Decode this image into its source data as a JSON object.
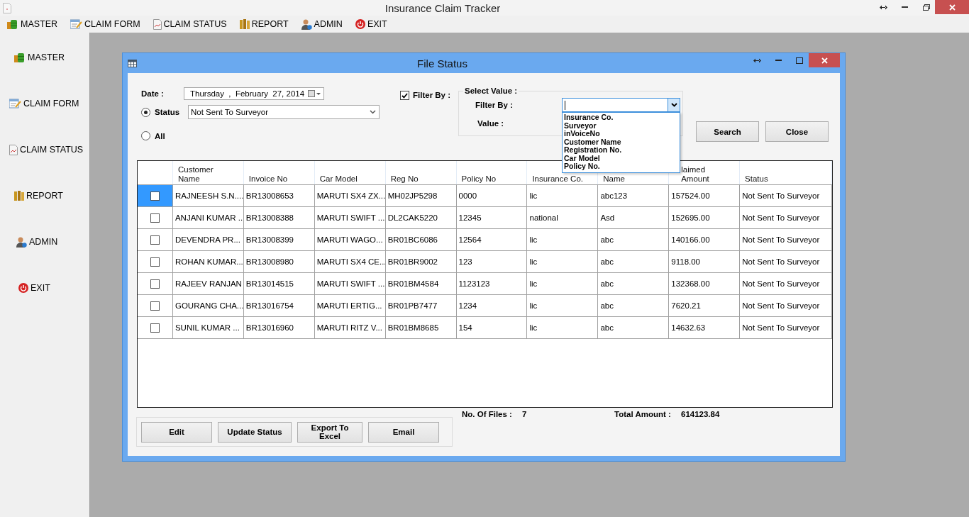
{
  "window": {
    "title": "Insurance Claim Tracker"
  },
  "menu": [
    {
      "label": "MASTER",
      "kind": "master"
    },
    {
      "label": "CLAIM FORM",
      "kind": "form"
    },
    {
      "label": "CLAIM STATUS",
      "kind": "status"
    },
    {
      "label": "REPORT",
      "kind": "report"
    },
    {
      "label": "ADMIN",
      "kind": "admin"
    },
    {
      "label": "EXIT",
      "kind": "exit"
    }
  ],
  "sidebar": {
    "items": [
      {
        "label": "MASTER",
        "kind": "master"
      },
      {
        "label": "CLAIM FORM",
        "kind": "form"
      },
      {
        "label": "CLAIM STATUS",
        "kind": "status"
      },
      {
        "label": "REPORT",
        "kind": "report"
      },
      {
        "label": "ADMIN",
        "kind": "admin"
      },
      {
        "label": "EXIT",
        "kind": "exit"
      }
    ]
  },
  "dialog": {
    "title": "File Status",
    "date": {
      "label": "Date :",
      "value": "Thursday  ,  February  27, 2014"
    },
    "status_radio": {
      "label": "Status",
      "selected": true,
      "value": "Not Sent To Surveyor"
    },
    "all_radio": {
      "label": "All",
      "selected": false
    },
    "filter_check": {
      "label": "Filter By :",
      "checked": true
    },
    "select_group": {
      "title": "Select Value :",
      "filter_label": "Filter By :",
      "value_label": "Value :",
      "expanded": true,
      "options": [
        "Insurance Co.",
        "Surveyor",
        "inVoiceNo",
        "Customer Name",
        "Registration No.",
        "Car Model",
        "Policy No."
      ]
    },
    "buttons": [
      "Search",
      "Close"
    ],
    "table": {
      "columns": [
        "Customer Name",
        "Invoice No",
        "Car Model",
        "Reg No",
        "Policy No",
        "Insurance Co.",
        "Name",
        "laimed Amount",
        "Status"
      ],
      "rows": [
        {
          "selected": true,
          "checked": false,
          "cells": [
            "RAJNEESH S.N....",
            "BR13008653",
            "MARUTI SX4 ZX...",
            "MH02JP5298",
            "0000",
            "lic",
            "abc123",
            "157524.00",
            "Not Sent To Surveyor"
          ]
        },
        {
          "selected": false,
          "checked": false,
          "cells": [
            "ANJANI KUMAR ...",
            "BR13008388",
            "MARUTI SWIFT ...",
            "DL2CAK5220",
            "12345",
            "national",
            "Asd",
            "152695.00",
            "Not Sent To Surveyor"
          ]
        },
        {
          "selected": false,
          "checked": false,
          "cells": [
            "DEVENDRA PR...",
            "BR13008399",
            "MARUTI WAGO...",
            "BR01BC6086",
            "12564",
            "lic",
            "abc",
            "140166.00",
            "Not Sent To Surveyor"
          ]
        },
        {
          "selected": false,
          "checked": false,
          "cells": [
            "ROHAN KUMAR...",
            "BR13008980",
            "MARUTI SX4 CE...",
            "BR01BR9002",
            "123",
            "lic",
            "abc",
            "9118.00",
            "Not Sent To Surveyor"
          ]
        },
        {
          "selected": false,
          "checked": false,
          "cells": [
            "RAJEEV  RANJAN",
            "BR13014515",
            "MARUTI SWIFT ...",
            "BR01BM4584",
            "1123123",
            "lic",
            "abc",
            "132368.00",
            "Not Sent To Surveyor"
          ]
        },
        {
          "selected": false,
          "checked": false,
          "cells": [
            "GOURANG CHA...",
            "BR13016754",
            "MARUTI ERTIG...",
            "BR01PB7477",
            "1234",
            "lic",
            "abc",
            "7620.21",
            "Not Sent To Surveyor"
          ]
        },
        {
          "selected": false,
          "checked": false,
          "cells": [
            "SUNIL KUMAR ...",
            "BR13016960",
            "MARUTI RITZ V...",
            "BR01BM8685",
            "154",
            "lic",
            "abc",
            "14632.63",
            "Not Sent To Surveyor"
          ]
        }
      ]
    },
    "summary": {
      "files_label": "No. Of Files :",
      "files_count": "7",
      "total_label": "Total Amount :",
      "total_value": "614123.84"
    },
    "actions": [
      "Edit",
      "Update Status",
      "Export To Excel",
      "Email"
    ]
  }
}
